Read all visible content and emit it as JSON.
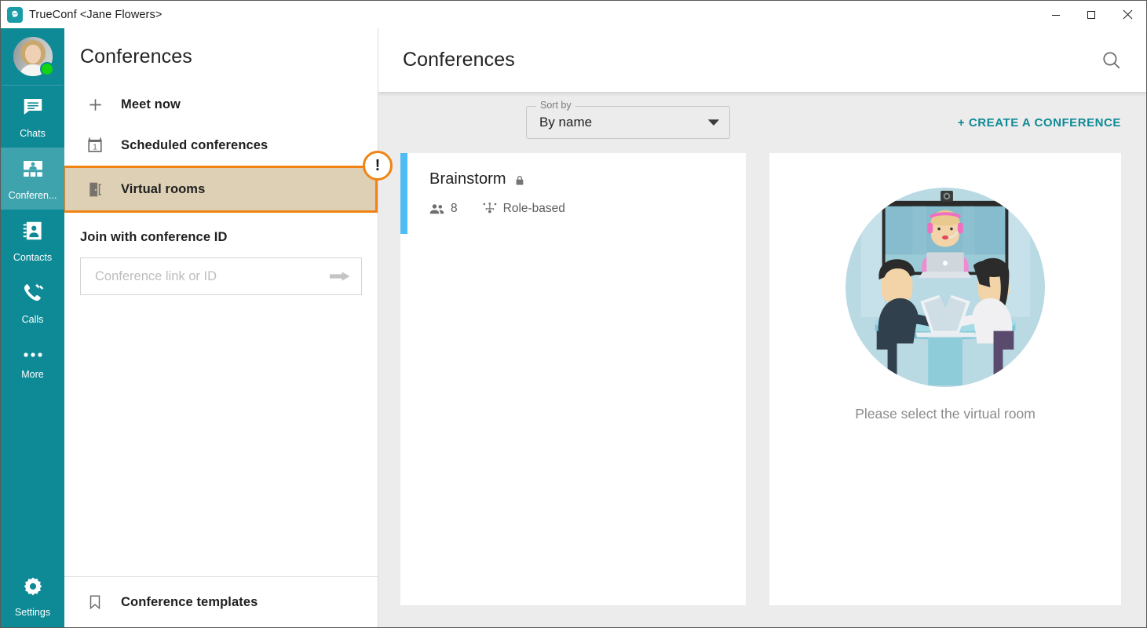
{
  "window": {
    "title": "TrueConf <Jane Flowers>",
    "app_icon": "trueconf-logo-icon",
    "controls": {
      "minimize": "minimize-icon",
      "maximize": "maximize-icon",
      "close": "close-icon"
    }
  },
  "rail": {
    "avatar": {
      "name": "Jane Flowers",
      "status": "online",
      "status_color": "#13d313"
    },
    "items": [
      {
        "label": "Chats",
        "icon": "chat-bubble-icon",
        "active": false
      },
      {
        "label": "Conferen...",
        "icon": "conference-grid-icon",
        "active": true
      },
      {
        "label": "Contacts",
        "icon": "contacts-book-icon",
        "active": false
      },
      {
        "label": "Calls",
        "icon": "phone-arrows-icon",
        "active": false
      },
      {
        "label": "More",
        "icon": "ellipsis-icon",
        "active": false
      }
    ],
    "settings": {
      "label": "Settings",
      "icon": "gear-icon"
    },
    "background": "#0e8a96",
    "active_background": "#3fa3ad"
  },
  "navpanel": {
    "title": "Conferences",
    "items": [
      {
        "label": "Meet now",
        "icon": "plus-icon",
        "highlighted": false
      },
      {
        "label": "Scheduled conferences",
        "icon": "calendar-icon",
        "highlighted": false
      },
      {
        "label": "Virtual rooms",
        "icon": "door-icon",
        "highlighted": true
      }
    ],
    "highlight": {
      "border_color": "#f08313",
      "fill_color": "#ded0b4",
      "badge_text": "!"
    },
    "join": {
      "title": "Join with conference ID",
      "placeholder": "Conference link or ID",
      "value": "",
      "submit_icon": "arrow-right-icon"
    },
    "bottom": {
      "label": "Conference templates",
      "icon": "bookmark-icon"
    }
  },
  "main": {
    "header": {
      "title": "Conferences",
      "search_icon": "search-icon"
    },
    "toolbar": {
      "sort_label": "Sort by",
      "sort_value": "By name",
      "sort_caret": "chevron-down-icon",
      "create_label": "+ CREATE A CONFERENCE",
      "create_color": "#0e8a96"
    },
    "conferences": [
      {
        "name": "Brainstorm",
        "locked": true,
        "lock_icon": "lock-icon",
        "participants_icon": "people-icon",
        "participants": "8",
        "type_icon": "role-based-icon",
        "type": "Role-based",
        "accent_color": "#4ebdf5"
      }
    ],
    "detail": {
      "illustration": "video-conference-room-illustration",
      "placeholder_text": "Please select the virtual room"
    }
  }
}
